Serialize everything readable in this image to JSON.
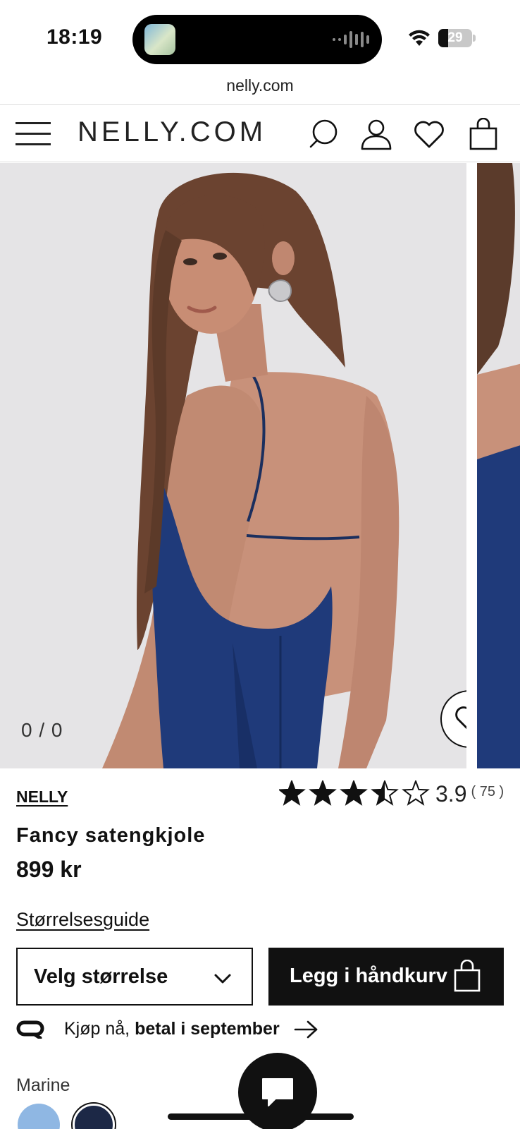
{
  "status_bar": {
    "time": "18:19",
    "battery": "29",
    "battery_level": 0.29
  },
  "browser": {
    "url": "nelly.com"
  },
  "header": {
    "logo": "NELLY.COM",
    "icons": [
      "menu-icon",
      "search-icon",
      "account-icon",
      "wishlist-icon",
      "cart-icon"
    ]
  },
  "gallery": {
    "counter": "0 / 0"
  },
  "product": {
    "brand": "NELLY",
    "rating_score": "3.9",
    "rating_count": "( 75 )",
    "rating_value": 3.9,
    "rating_max": 5,
    "title": "Fancy satengkjole",
    "price": "899 kr",
    "size_guide": "Størrelsesguide",
    "size_select": "Velg størrelse",
    "add_to_cart": "Legg i håndkurv",
    "klarna_prefix": "Kjøp nå, ",
    "klarna_bold": "betal i september",
    "color_label": "Marine",
    "swatches": [
      "#8fb7e3",
      "#1c2846"
    ]
  },
  "colors": {
    "dress": "#1f3a7a",
    "background": "#e4e3e5",
    "text": "#111111"
  }
}
